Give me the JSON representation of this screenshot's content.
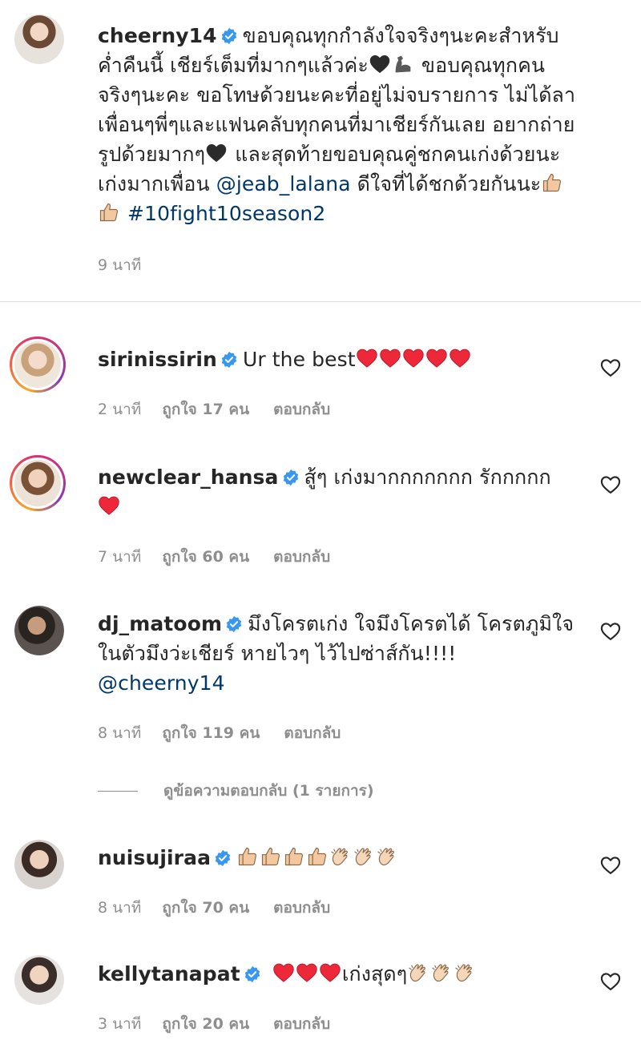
{
  "caption": {
    "username": "cheerny14",
    "text_1": "ขอบคุณทุกกำลังใจจริงๆนะคะสำหรับค่ำคืนนี้ เชียร์เต็มที่มากๆแล้วค่ะ",
    "text_2": " ขอบคุณทุกคนจริงๆนะคะ ขอโทษด้วยนะคะที่อยู่ไม่จบรายการ ไม่ได้ลาเพื่อนๆพี่ๆและแฟนคลับทุกคนที่มาเชียร์กันเลย อยากถ่ายรูปด้วยมากๆ",
    "text_3": " และสุดท้ายขอบคุณคู่ชกคนเก่งด้วยนะ เก่งมากเพื่อน ",
    "mention": "@jeab_lalana",
    "text_4": " ดีใจที่ได้ชกด้วยกันนะ",
    "hashtag": "#10fight10season2",
    "time": "9 นาที"
  },
  "comments": [
    {
      "username": "sirinissirin",
      "text": "Ur the best",
      "emoji": [
        "red-heart",
        "red-heart",
        "red-heart",
        "red-heart",
        "red-heart"
      ],
      "time": "2 นาที",
      "likes": "ถูกใจ 17 คน",
      "reply": "ตอบกลับ"
    },
    {
      "username": "newclear_hansa",
      "text": "สู้ๆ เก่งมากกกกกกก รักกกกก",
      "emoji": [
        "red-heart"
      ],
      "time": "7 นาที",
      "likes": "ถูกใจ 60 คน",
      "reply": "ตอบกลับ"
    },
    {
      "username": "dj_matoom",
      "text": "มึงโครตเก่ง ใจมึงโครตได้ โครตภูมิใจในตัวมึงว่ะเชียร์ หายไวๆ ไว้ไปซ่าส์กัน!!!!",
      "mention": "@cheerny14",
      "time": "8 นาที",
      "likes": "ถูกใจ 119 คน",
      "reply": "ตอบกลับ",
      "view_replies": "ดูข้อความตอบกลับ (1 รายการ)"
    },
    {
      "username": "nuisujiraa",
      "text": "",
      "emoji": [
        "thumbs-up",
        "thumbs-up",
        "thumbs-up",
        "thumbs-up",
        "clapping-hands",
        "clapping-hands",
        "clapping-hands"
      ],
      "time": "8 นาที",
      "likes": "ถูกใจ 70 คน",
      "reply": "ตอบกลับ"
    },
    {
      "username": "kellytanapat",
      "text": "เก่งสุดๆ",
      "emoji": [
        "red-heart",
        "red-heart",
        "red-heart",
        "clapping-hands",
        "clapping-hands",
        "clapping-hands"
      ],
      "time": "3 นาที",
      "likes": "ถูกใจ 20 คน",
      "reply": "ตอบกลับ"
    }
  ],
  "colors": {
    "link": "#00376b",
    "meta": "#8e8e8e",
    "heart": "#ed2939",
    "verified": "#3897f0"
  }
}
